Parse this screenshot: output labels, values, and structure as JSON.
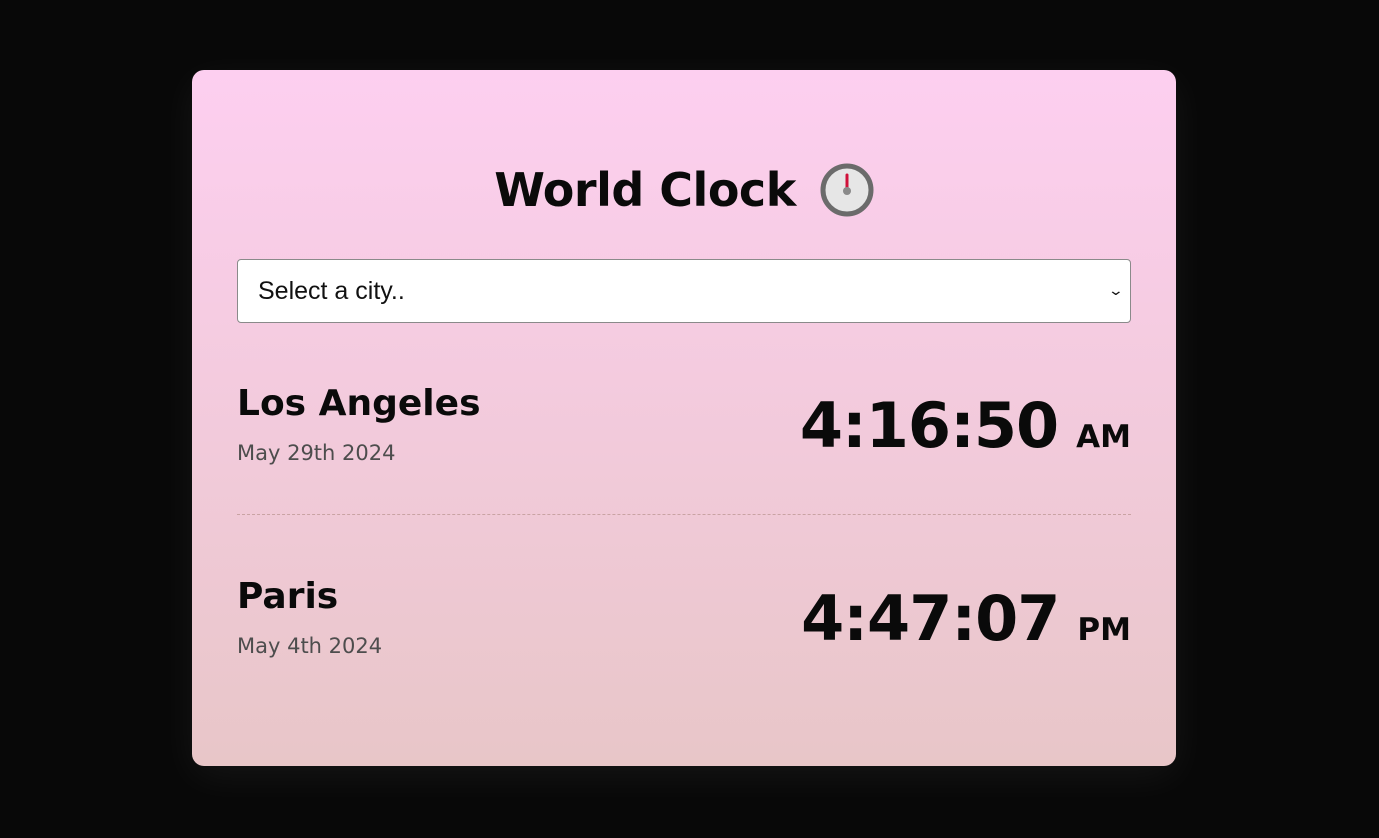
{
  "app": {
    "title": "World Clock",
    "title_icon": "stopwatch-icon"
  },
  "city_select": {
    "selected_value": "Select a city..",
    "icon": "chevron-down-icon"
  },
  "cities": [
    {
      "name": "Los Angeles",
      "date": "May 29th 2024",
      "time": "4:16:50",
      "ampm": "AM"
    },
    {
      "name": "Paris",
      "date": "May 4th 2024",
      "time": "4:47:07",
      "ampm": "PM"
    }
  ],
  "colors": {
    "background": "#080808",
    "card_gradient_top": "#fdcff0",
    "card_gradient_bottom": "#e8c6c8",
    "text": "#0a0a0a",
    "date_text": "#4d4d4d"
  }
}
